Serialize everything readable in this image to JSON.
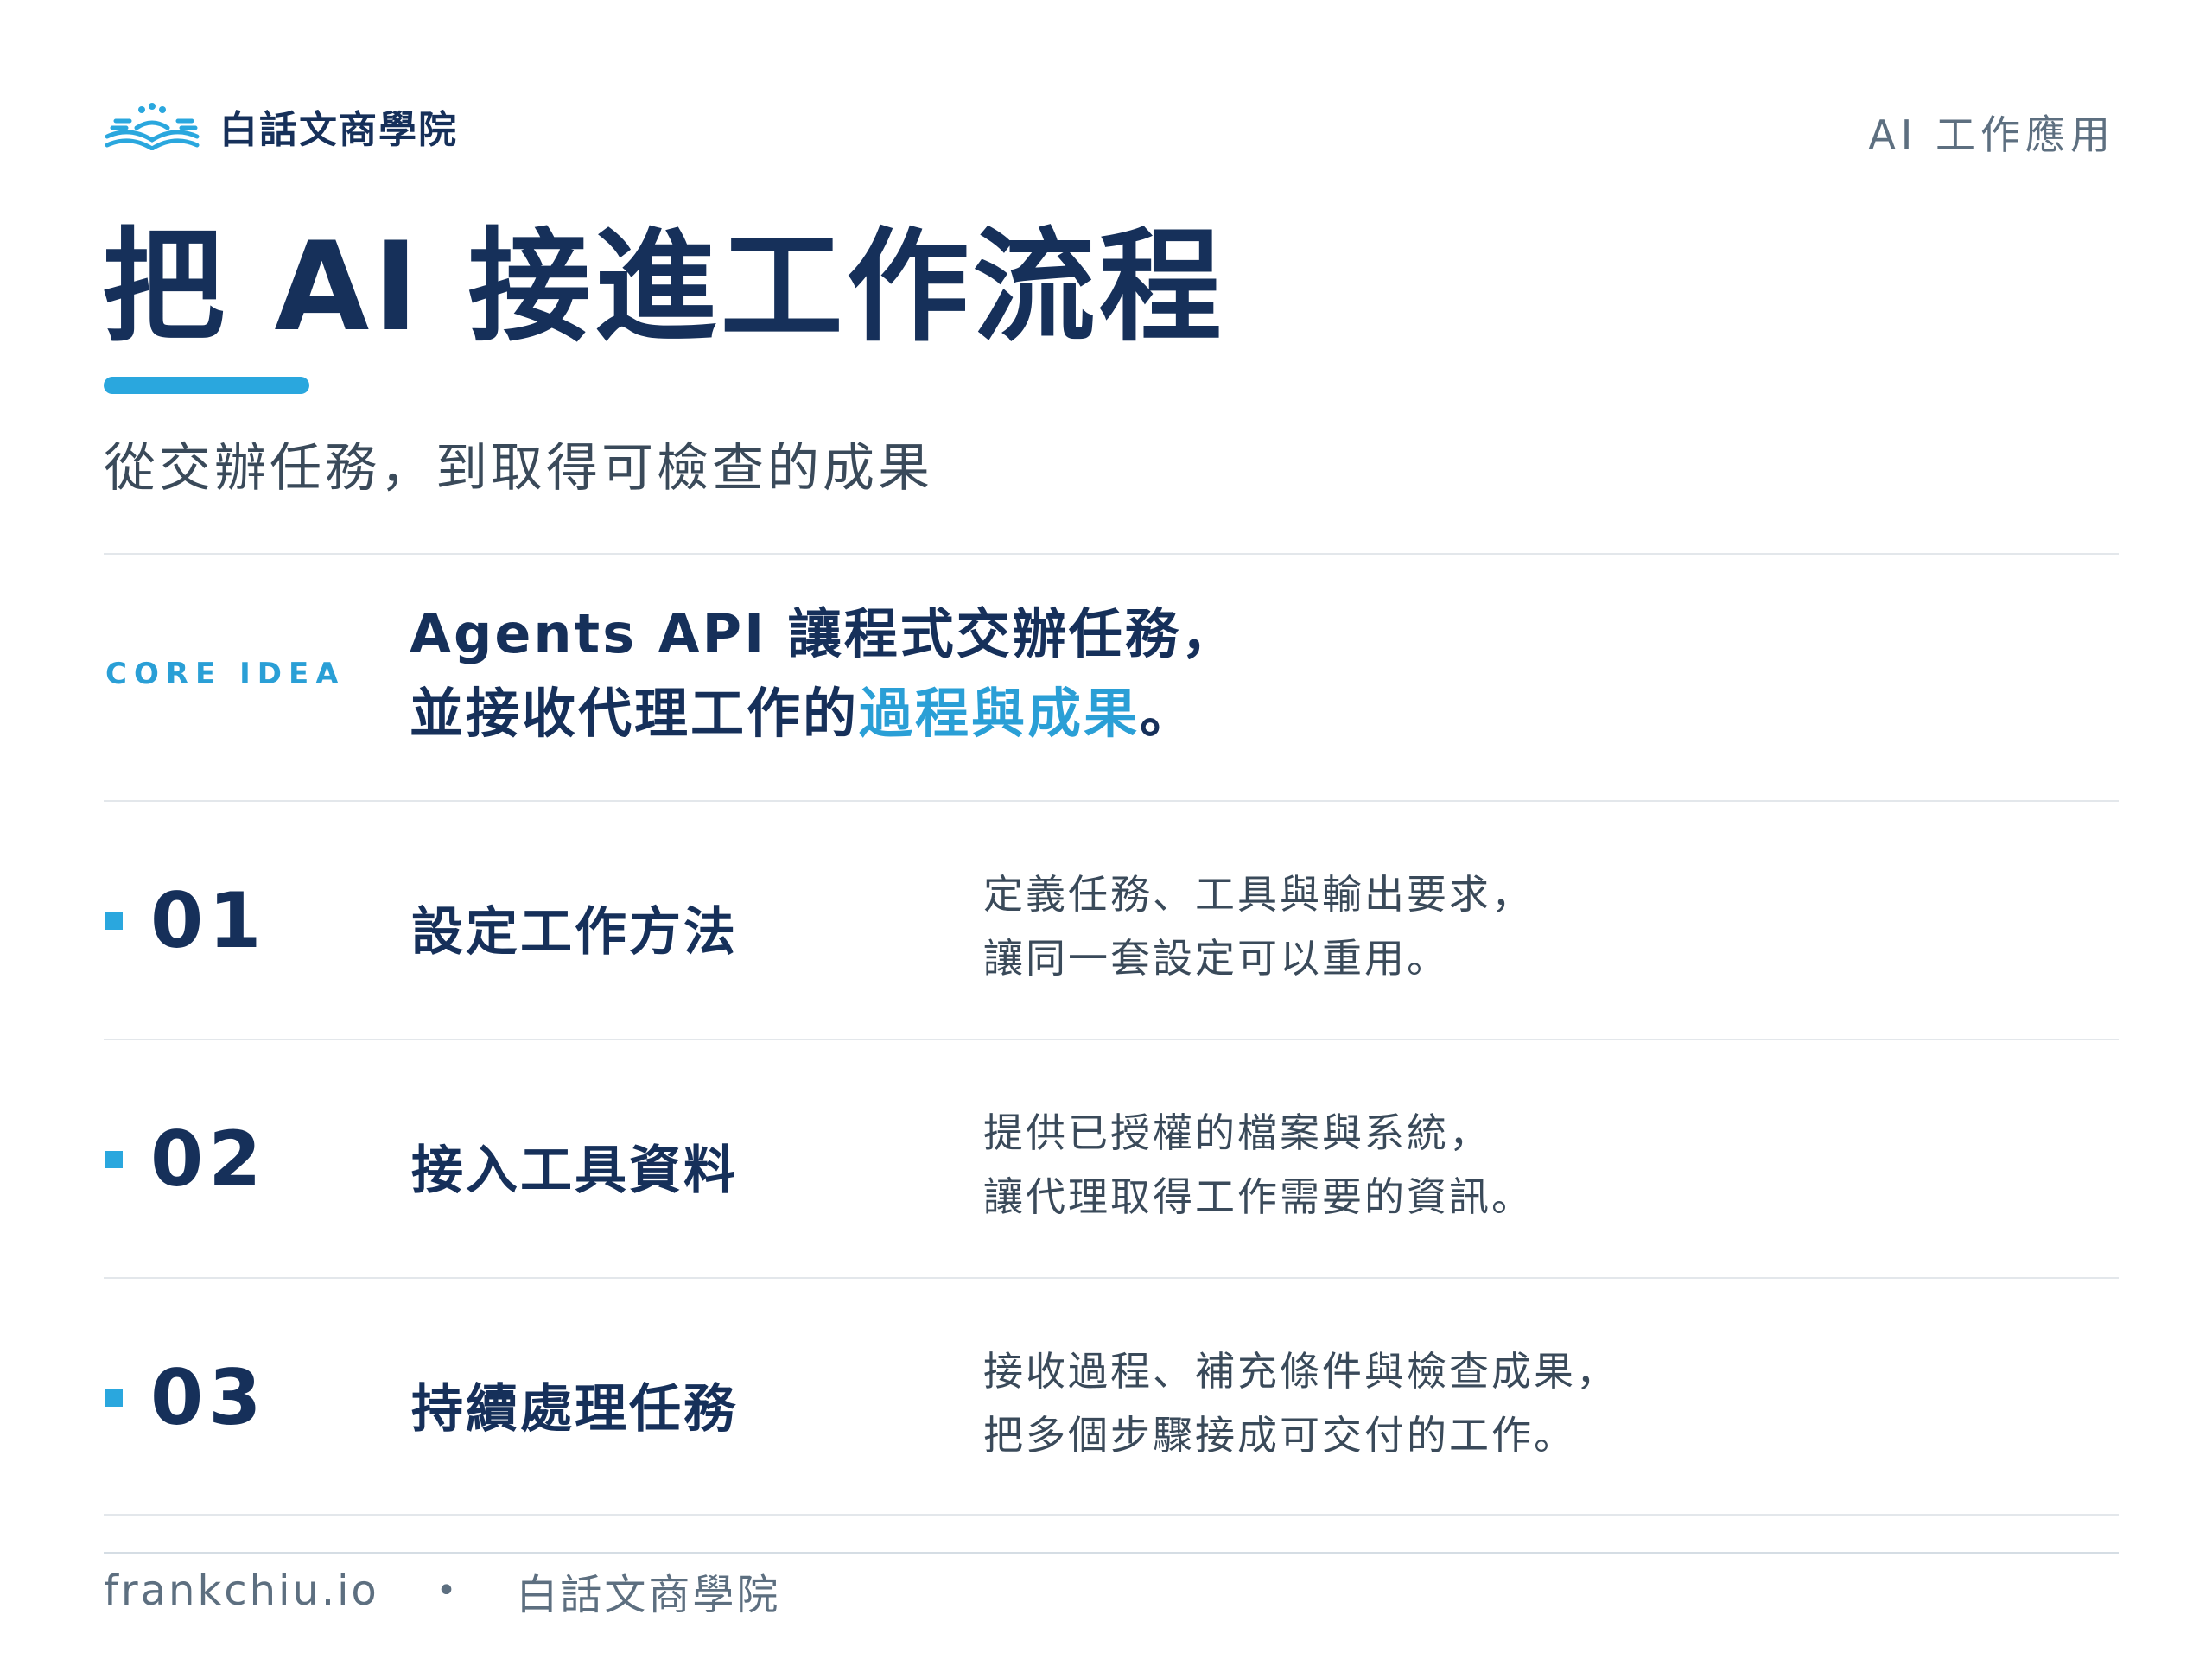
{
  "header": {
    "brand_name": "白話文商學院",
    "category": "AI 工作應用",
    "logo_icon": "book-logo-icon"
  },
  "title": "把 AI 接進工作流程",
  "subtitle": "從交辦任務，到取得可檢查的成果",
  "core": {
    "label": "CORE IDEA",
    "line1": "Agents API 讓程式交辦任務，",
    "line2_pre": "並接收代理工作的",
    "line2_highlight": "過程與成果",
    "line2_post": "。"
  },
  "steps": [
    {
      "num": "01",
      "name": "設定工作方法",
      "desc1": "定義任務、工具與輸出要求，",
      "desc2": "讓同一套設定可以重用。"
    },
    {
      "num": "02",
      "name": "接入工具資料",
      "desc1": "提供已授權的檔案與系統，",
      "desc2": "讓代理取得工作需要的資訊。"
    },
    {
      "num": "03",
      "name": "持續處理任務",
      "desc1": "接收過程、補充條件與檢查成果，",
      "desc2": "把多個步驟接成可交付的工作。"
    }
  ],
  "footer": {
    "site": "frankchiu.io",
    "separator": "•",
    "brand": "白話文商學院"
  },
  "colors": {
    "navy": "#16305a",
    "accent": "#2aa7de",
    "gray": "#5d6f80",
    "divider": "#e3e7eb"
  }
}
